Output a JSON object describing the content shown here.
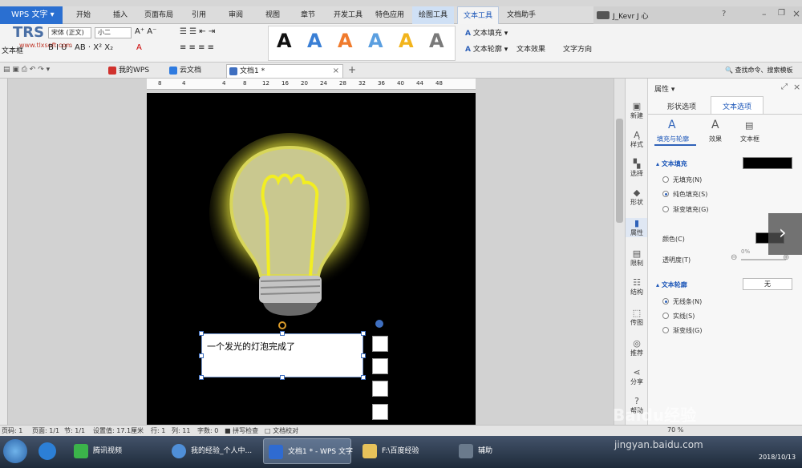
{
  "menubar": {
    "app_title": "WPS 文字",
    "menus": [
      "开始",
      "插入",
      "页面布局",
      "引用",
      "审阅",
      "视图",
      "章节",
      "开发工具",
      "特色应用",
      "绘图工具",
      "文本工具",
      "文档助手"
    ],
    "user": "J_Kevr J 心"
  },
  "ribbon": {
    "watermark_line1": "TRS",
    "watermark_line2": "www.tlxsoft.com",
    "font_name": "宋体 (正文)",
    "font_size": "小二",
    "textbox_label": "文本框",
    "fill_label": "文本填充",
    "outline_label": "文本轮廓",
    "effect_label": "文本效果",
    "direction_label": "文字方向",
    "style_letter": "A",
    "style_colors": [
      "#111111",
      "#3a7fd5",
      "#f07b2d",
      "#5b9fe0",
      "#f2b41c",
      "#7a7a7a"
    ]
  },
  "tabbar": {
    "tabs": [
      "我的WPS",
      "云文档",
      "文档1 *"
    ],
    "search": "查找命令、搜索模板"
  },
  "ruler": [
    "8",
    "4",
    "4",
    "8",
    "12",
    "16",
    "20",
    "24",
    "28",
    "32",
    "36",
    "40",
    "44",
    "48"
  ],
  "textbox": {
    "text": "一个发光的灯泡完成了"
  },
  "sidestrip": [
    "新建",
    "样式",
    "选择",
    "形状",
    "属性",
    "限制",
    "结构",
    "传图",
    "推荐",
    "分享",
    "帮助"
  ],
  "panel": {
    "title": "属性 ▾",
    "tabs": [
      "形状选项",
      "文本选项"
    ],
    "subtabs": [
      "填充与轮廓",
      "效果",
      "文本框"
    ],
    "fill_section": "文本填充",
    "fill_options": [
      "无填充(N)",
      "纯色填充(S)",
      "渐变填充(G)"
    ],
    "color_label": "颜色(C)",
    "transparency_label": "透明度(T)",
    "transparency_value": "0%",
    "outline_section": "文本轮廓",
    "outline_value": "无",
    "outline_options": [
      "无线条(N)",
      "实线(S)",
      "渐变线(G)"
    ]
  },
  "status": {
    "page_no": "页码: 1",
    "pages": "页面: 1/1",
    "section": "节: 1/1",
    "setting": "设置值: 17.1厘米",
    "row": "行: 1",
    "col": "列: 11",
    "words": "字数: 0",
    "spell": "拼写检查",
    "proof": "文档校对",
    "zoom": "70 %"
  },
  "taskbar": {
    "items": [
      "腾讯视频",
      "我的经验_个人中...",
      "文档1 * - WPS 文字",
      "F:\\百度经验",
      "辅助"
    ],
    "time": "2018/10/13",
    "watermark": "jingyan.baidu.com",
    "baidu": "Baidu经验"
  }
}
